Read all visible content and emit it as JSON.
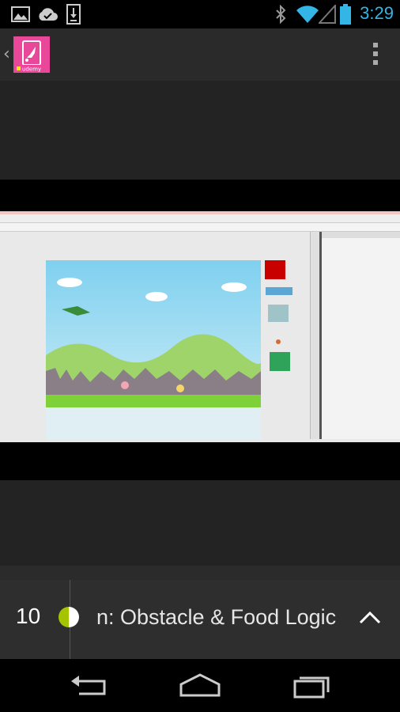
{
  "status_bar": {
    "time": "3:29",
    "accent_color": "#33b5e5",
    "icons": [
      "image-notification-icon",
      "cloud-sync-icon",
      "download-icon",
      "bluetooth-icon",
      "wifi-icon",
      "signal-icon",
      "battery-icon"
    ]
  },
  "action_bar": {
    "logo_text": "udemy",
    "logo_color": "#e8479a",
    "icons": [
      "up-caret-icon",
      "overflow-menu-icon"
    ]
  },
  "player": {
    "lecture_number": "10",
    "lecture_title": "n: Obstacle & Food Logic",
    "progress_fraction": 0.5,
    "progress_color": "#a6c300"
  },
  "nav_bar": {
    "icons": [
      "back-icon",
      "home-icon",
      "recents-icon"
    ]
  }
}
